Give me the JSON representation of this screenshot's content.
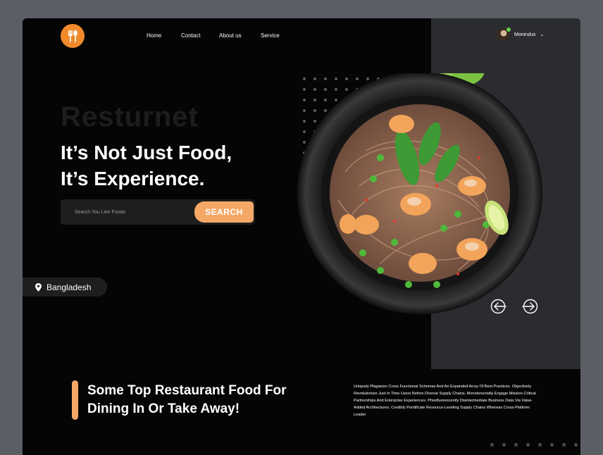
{
  "nav": {
    "items": [
      {
        "label": "Home"
      },
      {
        "label": "Contact"
      },
      {
        "label": "About us"
      },
      {
        "label": "Service"
      }
    ]
  },
  "user": {
    "name": "Monirulux",
    "status": "online"
  },
  "hero": {
    "brand": "Resturnet",
    "headline_line1": "It’s Not Just Food,",
    "headline_line2": "It’s Experience."
  },
  "search": {
    "placeholder": "Search You Like Foods",
    "value": "",
    "button_label": "SEARCH"
  },
  "location": {
    "label": "Bangladesh"
  },
  "section": {
    "title_line1": "Some Top Restaurant Food For",
    "title_line2": "Dining In Or Take Away!",
    "paragraph": "Uniquely Plagiarize Cross Functional Schemas And An Expanded Array Of Best Practices. Objectively Revolutionize Just In Time Users Before Diverse Supply Chains. Monotonectally Engage Mission-Critical Partnerships And Enterprise Experiences. Phosfluorescently Disintermediate Business Data Via Value-Added Architectures. Credibly Pontificate Resource-Leveling Supply Chains Whereas Cross-Platform Leader"
  },
  "colors": {
    "accent": "#f5a866",
    "logo": "#f08a2a",
    "background": "#050505",
    "panel": "#2b2c2f"
  },
  "icons": [
    "fork-spoon-logo-icon",
    "chevron-down-icon",
    "location-pin-icon",
    "arrow-left-icon",
    "arrow-right-icon"
  ]
}
